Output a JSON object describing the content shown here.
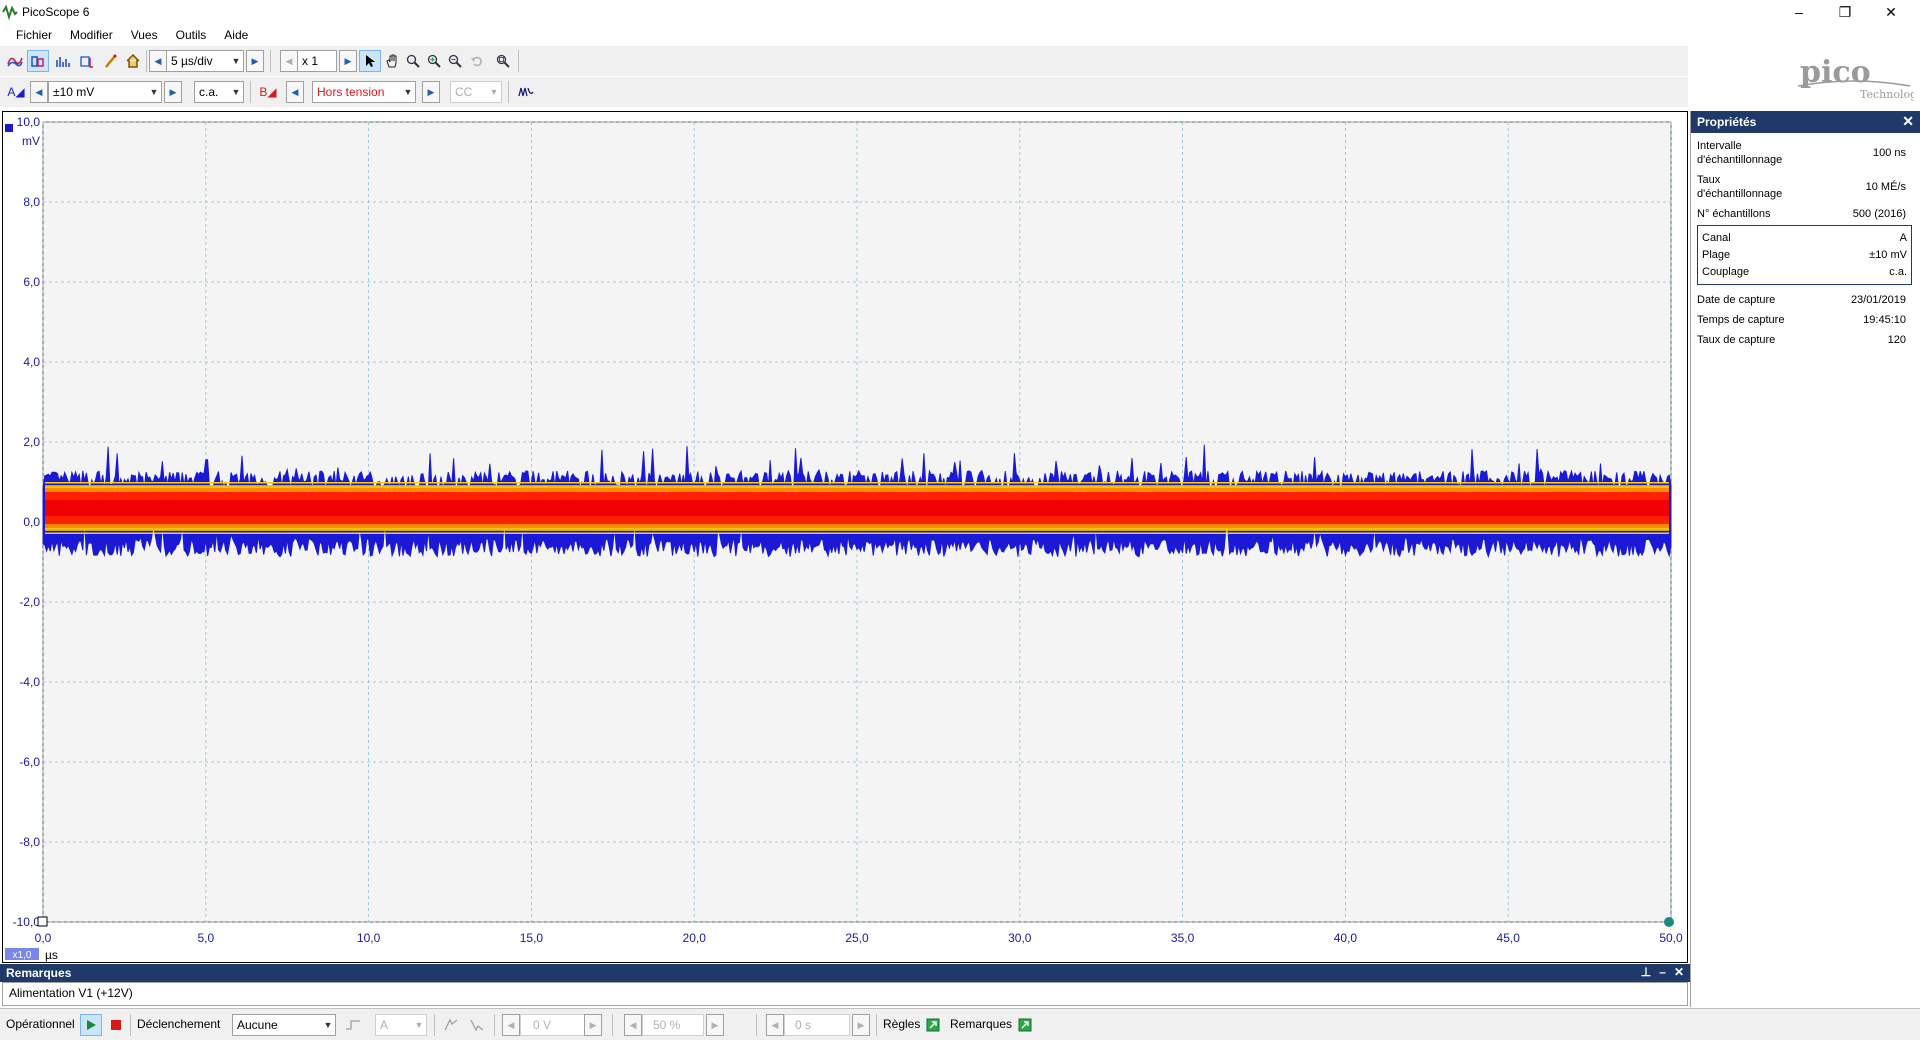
{
  "window": {
    "title": "PicoScope 6",
    "minimize": "–",
    "maximize": "❐",
    "close": "✕"
  },
  "menu": [
    "Fichier",
    "Modifier",
    "Vues",
    "Outils",
    "Aide"
  ],
  "toolbar": {
    "timebase": "5 µs/div",
    "zoom": "x 1"
  },
  "channel_a": {
    "label": "A",
    "range": "±10 mV",
    "coupling": "c.a.",
    "color": "#1a1ad6"
  },
  "channel_b": {
    "label": "B",
    "range": "Hors tension",
    "coupling": "CC",
    "color": "#d61a1a"
  },
  "logo": {
    "name": "pico",
    "sub": "Technology"
  },
  "chart_data": {
    "type": "line",
    "title": "",
    "xlabel": "µs",
    "ylabel": "mV",
    "xlim": [
      0,
      50
    ],
    "ylim": [
      -10,
      10
    ],
    "x_ticks": [
      "0,0",
      "5,0",
      "10,0",
      "15,0",
      "20,0",
      "25,0",
      "30,0",
      "35,0",
      "40,0",
      "45,0",
      "50,0"
    ],
    "y_ticks": [
      "10,0",
      "8,0",
      "6,0",
      "4,0",
      "2,0",
      "0,0",
      "-2,0",
      "-4,0",
      "-6,0",
      "-8,0",
      "-10,0"
    ],
    "x_zoom_badge": "x1,0",
    "grid": true,
    "series": [
      {
        "channel": "A",
        "color": "#1a1ad6",
        "band_mv": [
          -0.6,
          1.1
        ],
        "core_mv": [
          -0.1,
          0.8
        ],
        "peak_max_mv": 1.8,
        "peak_min_mv": -1.2
      }
    ]
  },
  "properties": {
    "header": "Propriétés",
    "rows": [
      {
        "label": "Intervalle d'échantillonnage",
        "value": "100 ns"
      },
      {
        "label": "Taux d'échantillonnage",
        "value": "10 MÉ/s"
      },
      {
        "label": "N° échantillons",
        "value": "500  (2016)"
      }
    ],
    "channel_box": [
      {
        "label": "Canal",
        "value": "A"
      },
      {
        "label": "Plage",
        "value": "±10 mV"
      },
      {
        "label": "Couplage",
        "value": "c.a."
      }
    ],
    "capture": [
      {
        "label": "Date de capture",
        "value": "23/01/2019"
      },
      {
        "label": "Temps de capture",
        "value": "19:45:10"
      },
      {
        "label": "Taux de capture",
        "value": "120"
      }
    ]
  },
  "remarks": {
    "header": "Remarques",
    "text": "Alimentation V1 (+12V)"
  },
  "status": {
    "mode": "Opérationnel",
    "trigger_label": "Déclenchement",
    "trigger_value": "Aucune",
    "trigger_channel": "A",
    "threshold": "0 V",
    "pretrigger": "50 %",
    "delay": "0 s",
    "rules": "Règles",
    "notes": "Remarques"
  }
}
